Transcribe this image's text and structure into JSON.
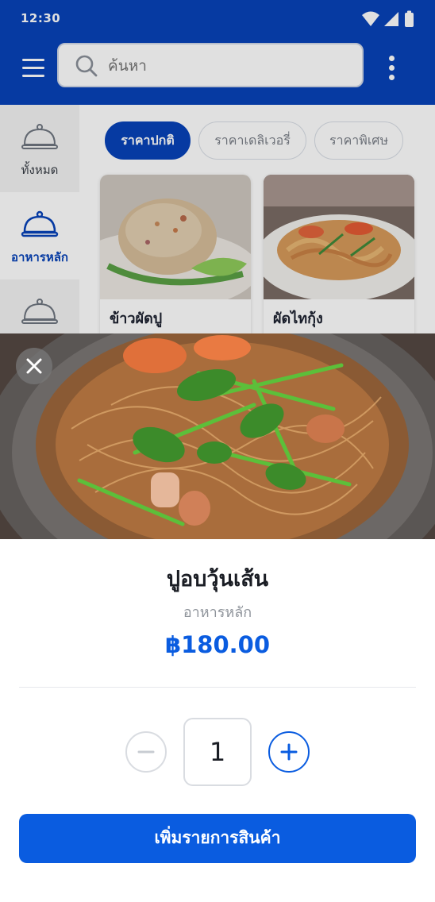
{
  "status_bar": {
    "time": "12:30",
    "icons": [
      "wifi-icon",
      "cellular-signal-icon",
      "battery-icon"
    ]
  },
  "app_bar": {
    "menu_icon": "hamburger-menu-icon",
    "search": {
      "placeholder": "ค้นหา",
      "value": "",
      "icon": "search-icon"
    },
    "more_icon": "more-vertical-icon"
  },
  "sidebar": {
    "items": [
      {
        "label": "ทั้งหมด",
        "icon": "cloche-icon",
        "active": false
      },
      {
        "label": "อาหารหลัก",
        "icon": "cloche-icon",
        "active": true
      },
      {
        "label": "",
        "icon": "cloche-icon",
        "active": false
      }
    ]
  },
  "price_tabs": [
    {
      "label": "ราคาปกติ",
      "active": true
    },
    {
      "label": "ราคาเดลิเวอรี่",
      "active": false
    },
    {
      "label": "ราคาพิเศษ",
      "active": false
    }
  ],
  "menu_items": [
    {
      "name": "ข้าวผัดปู"
    },
    {
      "name": "ผัดไทกุ้ง"
    }
  ],
  "product_sheet": {
    "title": "ปูอบวุ้นเส้น",
    "category": "อาหารหลัก",
    "price": "฿180.00",
    "quantity": "1",
    "add_button_label": "เพิ่มรายการสินค้า",
    "close_icon": "close-icon",
    "minus_icon": "minus-icon",
    "plus_icon": "plus-icon"
  },
  "colors": {
    "primary": "#0743b9",
    "accent": "#0a5ce0",
    "text_dark": "#1a1d24",
    "text_muted": "#8f949b"
  }
}
